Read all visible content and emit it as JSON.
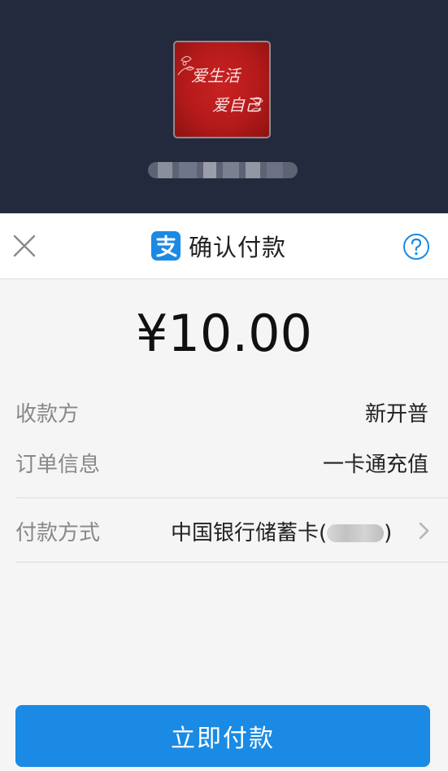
{
  "merchant": {
    "avatar_text_line1": "爱生活",
    "avatar_text_line2": "爱自己"
  },
  "header": {
    "title": "确认付款",
    "logo_icon": "alipay-logo-icon",
    "close_icon": "close-icon",
    "help_icon": "help-icon"
  },
  "payment": {
    "amount": "¥10.00"
  },
  "details": {
    "payee_label": "收款方",
    "payee_value": "新开普",
    "order_label": "订单信息",
    "order_value": "一卡通充值",
    "method_label": "付款方式",
    "method_value_prefix": "中国银行储蓄卡(",
    "method_value_suffix": ")"
  },
  "actions": {
    "pay_label": "立即付款"
  },
  "colors": {
    "header_background": "#232a3d",
    "accent_blue": "#1a8ae4",
    "page_background": "#f5f5f5"
  }
}
